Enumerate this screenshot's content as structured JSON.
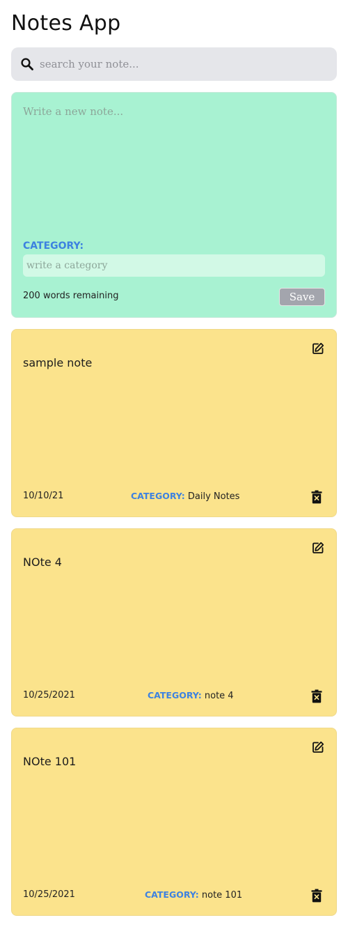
{
  "app": {
    "title": "Notes App"
  },
  "search": {
    "placeholder": "search your note...",
    "icon": "search-icon"
  },
  "new_note": {
    "placeholder": "Write a new note...",
    "category_label": "CATEGORY:",
    "category_placeholder": "write a category",
    "remaining_text": "200 words remaining",
    "save_label": "Save",
    "background": "#a8f2d2"
  },
  "notes": [
    {
      "text": "sample note",
      "date": "10/10/21",
      "category_label": "CATEGORY:",
      "category": "Daily Notes"
    },
    {
      "text": "NOte 4",
      "date": "10/25/2021",
      "category_label": "CATEGORY:",
      "category": "note 4"
    },
    {
      "text": "NOte 101",
      "date": "10/25/2021",
      "category_label": "CATEGORY:",
      "category": "note 101"
    }
  ],
  "icons": {
    "edit": "edit-icon",
    "delete": "delete-icon"
  },
  "colors": {
    "note_background": "#fbe38c",
    "accent": "#3d82e0",
    "search_background": "#e5e6ea",
    "save_button": "#a3a5ad"
  }
}
